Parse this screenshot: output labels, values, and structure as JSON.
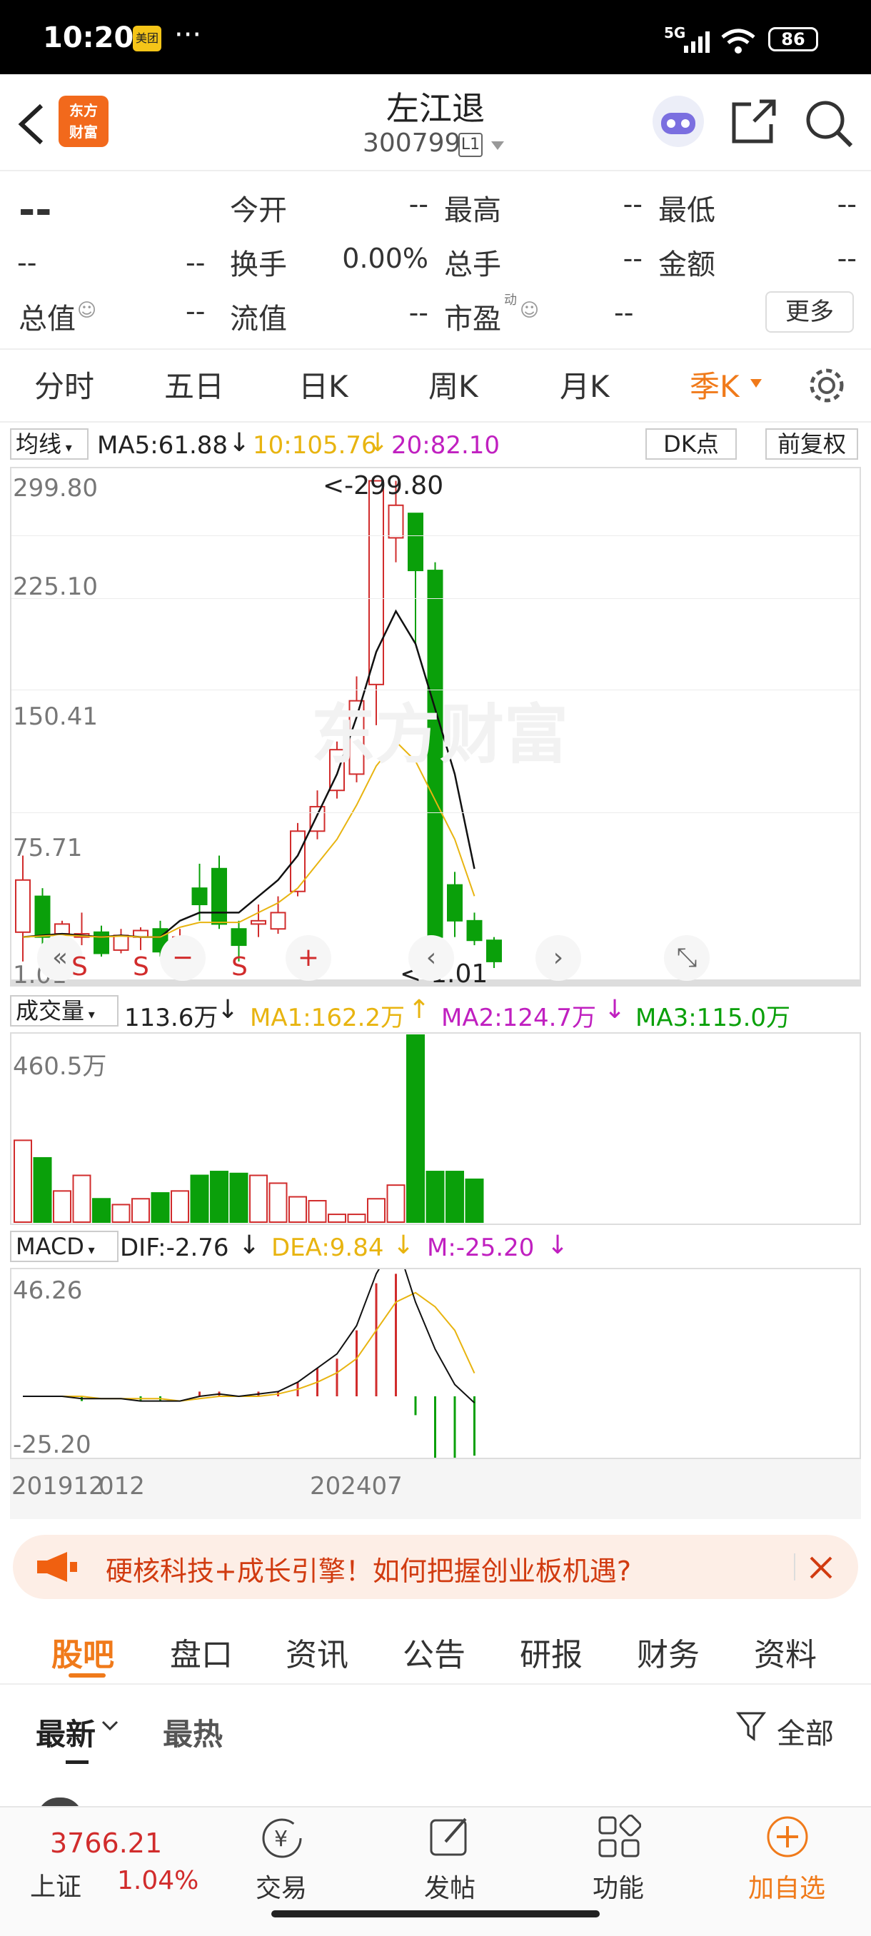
{
  "status_bar": {
    "time": "10:20",
    "app_badge": "美团",
    "dots": "···",
    "network": "5G",
    "battery": "86"
  },
  "header": {
    "logo_text": "东方\n财富",
    "title": "左江退",
    "code": "300799",
    "level": "L1"
  },
  "quote": {
    "price": "--",
    "change": "--",
    "change_pct": "--",
    "open_label": "今开",
    "open": "--",
    "high_label": "最高",
    "high": "--",
    "low_label": "最低",
    "low": "--",
    "turnover_label": "换手",
    "turnover": "0.00%",
    "vol_label": "总手",
    "vol": "--",
    "amount_label": "金额",
    "amount": "--",
    "mktcap_label": "总值",
    "mktcap": "--",
    "float_label": "流值",
    "float": "--",
    "pe_label": "市盈",
    "pe_sup": "动",
    "pe": "--",
    "more": "更多"
  },
  "tabs": [
    "分时",
    "五日",
    "日K",
    "周K",
    "月K",
    "季K"
  ],
  "active_tab": "季K",
  "ma_bar": {
    "selector": "均线",
    "ma5": "MA5:61.88",
    "ma10": "10:105.76",
    "ma20": "20:82.10",
    "dk": "DK点",
    "fq": "前复权"
  },
  "price_axis": [
    "299.80",
    "225.10",
    "150.41",
    "75.71",
    "1.01"
  ],
  "max_label": "<-299.80",
  "min_label": "<-1.01",
  "watermark": "东方财富",
  "markers": [
    "S",
    "S",
    "S"
  ],
  "vol_bar": {
    "selector": "成交量",
    "vol": "113.6万",
    "ma1": "MA1:162.2万",
    "ma2": "MA2:124.7万",
    "ma3": "MA3:115.0万"
  },
  "vol_axis": "460.5万",
  "macd_bar": {
    "selector": "MACD",
    "dif": "DIF:-2.76",
    "dea": "DEA:9.84",
    "m": "M:-25.20"
  },
  "macd_axis": [
    "46.26",
    "-25.20"
  ],
  "date_axis": [
    "201912",
    "012",
    "202407"
  ],
  "banner": {
    "text": "硬核科技+成长引擎！如何把握创业板机遇?"
  },
  "sub_tabs": [
    "股吧",
    "盘口",
    "资讯",
    "公告",
    "研报",
    "财务",
    "资料"
  ],
  "active_sub_tab": "股吧",
  "feed": {
    "latest": "最新",
    "hot": "最热",
    "filter": "全部"
  },
  "bottom": {
    "index_value": "3766.21",
    "index_name": "上证",
    "index_pct": "1.04%",
    "trade": "交易",
    "post": "发帖",
    "func": "功能",
    "add": "加自选"
  },
  "colors": {
    "up": "#d12c2c",
    "down": "#0aa00a",
    "accent": "#f07a1a",
    "ma10": "#e8b410",
    "ma20": "#c020c0"
  },
  "chart_data": {
    "type": "candlestick",
    "x": [
      "201912",
      "202003",
      "202006",
      "202009",
      "202012",
      "202103",
      "202106",
      "202109",
      "202112",
      "202203",
      "202206",
      "202209",
      "202212",
      "202303",
      "202306",
      "202309",
      "202312",
      "202403",
      "202406",
      "202407"
    ],
    "open": [
      23,
      45,
      22,
      20,
      23,
      12,
      20,
      25,
      10,
      50,
      62,
      25,
      28,
      25,
      48,
      85,
      110,
      120,
      175,
      265,
      280,
      245,
      52,
      30,
      18
    ],
    "close": [
      55,
      20,
      28,
      22,
      10,
      21,
      24,
      11,
      20,
      40,
      28,
      15,
      30,
      35,
      85,
      100,
      135,
      165,
      300,
      285,
      245,
      20,
      30,
      18,
      5
    ],
    "high": [
      70,
      50,
      30,
      35,
      27,
      25,
      26,
      30,
      25,
      65,
      70,
      30,
      40,
      45,
      90,
      110,
      140,
      180,
      300,
      300,
      260,
      250,
      60,
      35,
      20
    ],
    "low": [
      5,
      15,
      18,
      15,
      8,
      10,
      12,
      8,
      5,
      30,
      25,
      5,
      20,
      22,
      45,
      80,
      105,
      115,
      150,
      250,
      200,
      18,
      20,
      15,
      1
    ],
    "ma5": [
      20,
      21,
      22,
      21,
      20,
      21,
      20,
      20,
      30,
      35,
      35,
      35,
      45,
      55,
      70,
      95,
      120,
      155,
      195,
      220,
      200,
      160,
      120,
      61.88
    ],
    "volume": [
      420,
      330,
      160,
      240,
      120,
      90,
      120,
      150,
      160,
      240,
      260,
      250,
      240,
      200,
      130,
      110,
      40,
      40,
      120,
      190,
      960,
      260,
      260,
      220
    ],
    "ylim": [
      1.01,
      299.8
    ],
    "vol_ylim": [
      0,
      460.5
    ]
  }
}
